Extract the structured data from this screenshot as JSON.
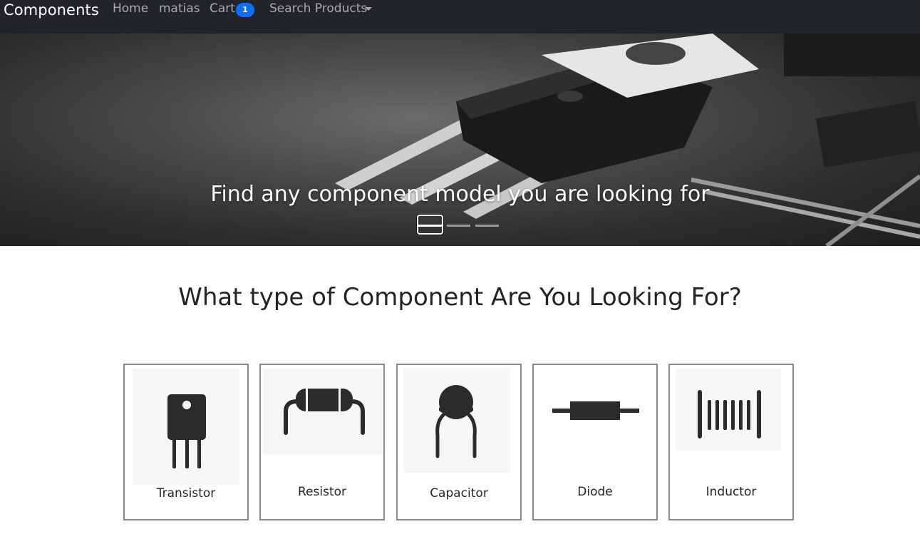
{
  "navbar": {
    "brand": "Components",
    "links": {
      "home": "Home",
      "user": "matias",
      "cart": "Cart",
      "cart_count": "1",
      "search": "Search Products"
    }
  },
  "hero": {
    "caption": "Find any component model you are looking for",
    "slide_count": 3,
    "active_slide": 1
  },
  "section": {
    "heading": "What type of Component Are You Looking For?"
  },
  "categories": [
    {
      "label": "Transistor",
      "icon": "transistor-icon"
    },
    {
      "label": "Resistor",
      "icon": "resistor-icon"
    },
    {
      "label": "Capacitor",
      "icon": "capacitor-icon"
    },
    {
      "label": "Diode",
      "icon": "diode-icon"
    },
    {
      "label": "Inductor",
      "icon": "inductor-icon"
    }
  ],
  "colors": {
    "navbar_bg": "#212529",
    "badge_bg": "#0d6efd",
    "icon_fill": "#2b2b2b"
  }
}
